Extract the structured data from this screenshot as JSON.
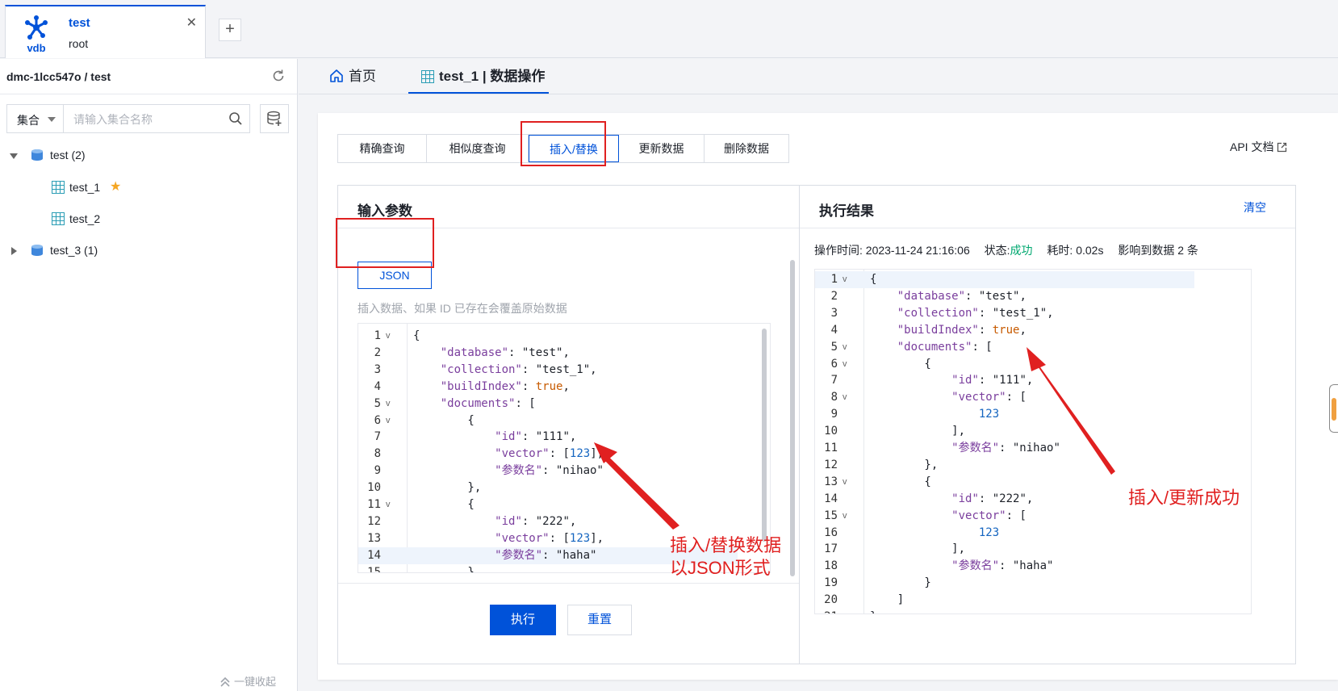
{
  "connection_tab": {
    "logo_text": "vdb",
    "name": "test",
    "user": "root",
    "close_glyph": "✕",
    "add_glyph": "+"
  },
  "sidebar": {
    "path_title": "dmc-1lcc547o / test",
    "refresh_icon": "refresh-icon",
    "search": {
      "scope": "集合",
      "placeholder": "请输入集合名称"
    },
    "tree": [
      {
        "label": "test (2)",
        "expanded": true,
        "children": [
          {
            "label": "test_1",
            "starred": true
          },
          {
            "label": "test_2",
            "starred": false
          }
        ]
      },
      {
        "label": "test_3 (1)",
        "expanded": false
      }
    ],
    "collapse_all": "一键收起"
  },
  "main_tabs": [
    {
      "label": "首页",
      "icon": "home-icon",
      "active": false
    },
    {
      "label": "test_1 | 数据操作",
      "icon": "table-icon",
      "active": true
    }
  ],
  "op_tabs": [
    {
      "label": "精确查询",
      "active": false
    },
    {
      "label": "相似度查询",
      "active": false
    },
    {
      "label": "插入/替换",
      "active": true
    },
    {
      "label": "更新数据",
      "active": false
    },
    {
      "label": "删除数据",
      "active": false
    }
  ],
  "api_doc": "API 文档",
  "input_panel": {
    "title": "输入参数",
    "format_button": "JSON",
    "hint": "插入数据、如果 ID 已存在会覆盖原始数据",
    "highlighted_line": 14,
    "code_lines": [
      [
        [
          "p",
          "{"
        ]
      ],
      [
        [
          "p",
          "    "
        ],
        [
          "k",
          "\"database\""
        ],
        [
          "p",
          ": "
        ],
        [
          "s",
          "\"test\""
        ],
        [
          "p",
          ","
        ]
      ],
      [
        [
          "p",
          "    "
        ],
        [
          "k",
          "\"collection\""
        ],
        [
          "p",
          ": "
        ],
        [
          "s",
          "\"test_1\""
        ],
        [
          "p",
          ","
        ]
      ],
      [
        [
          "p",
          "    "
        ],
        [
          "k",
          "\"buildIndex\""
        ],
        [
          "p",
          ": "
        ],
        [
          "b",
          "true"
        ],
        [
          "p",
          ","
        ]
      ],
      [
        [
          "p",
          "    "
        ],
        [
          "k",
          "\"documents\""
        ],
        [
          "p",
          ": ["
        ]
      ],
      [
        [
          "p",
          "        {"
        ]
      ],
      [
        [
          "p",
          "            "
        ],
        [
          "k",
          "\"id\""
        ],
        [
          "p",
          ": "
        ],
        [
          "s",
          "\"111\""
        ],
        [
          "p",
          ","
        ]
      ],
      [
        [
          "p",
          "            "
        ],
        [
          "k",
          "\"vector\""
        ],
        [
          "p",
          ": ["
        ],
        [
          "n",
          "123"
        ],
        [
          "p",
          "],"
        ]
      ],
      [
        [
          "p",
          "            "
        ],
        [
          "k",
          "\"参数名\""
        ],
        [
          "p",
          ": "
        ],
        [
          "s",
          "\"nihao\""
        ]
      ],
      [
        [
          "p",
          "        },"
        ]
      ],
      [
        [
          "p",
          "        {"
        ]
      ],
      [
        [
          "p",
          "            "
        ],
        [
          "k",
          "\"id\""
        ],
        [
          "p",
          ": "
        ],
        [
          "s",
          "\"222\""
        ],
        [
          "p",
          ","
        ]
      ],
      [
        [
          "p",
          "            "
        ],
        [
          "k",
          "\"vector\""
        ],
        [
          "p",
          ": ["
        ],
        [
          "n",
          "123"
        ],
        [
          "p",
          "],"
        ]
      ],
      [
        [
          "p",
          "            "
        ],
        [
          "k",
          "\"参数名\""
        ],
        [
          "p",
          ": "
        ],
        [
          "s",
          "\"haha\""
        ]
      ],
      [
        [
          "p",
          "        }"
        ]
      ]
    ],
    "fold_lines": [
      1,
      5,
      6,
      11
    ],
    "buttons": {
      "execute": "执行",
      "reset": "重置"
    }
  },
  "result_panel": {
    "title": "执行结果",
    "clear": "清空",
    "info": {
      "time_label": "操作时间:",
      "time_value": "2023-11-24 21:16:06",
      "status_label": "状态:",
      "status_value": "成功",
      "cost_label": "耗时:",
      "cost_value": "0.02s",
      "affected": "影响到数据 2 条"
    },
    "highlighted_line": 1,
    "code_lines": [
      [
        [
          "p",
          "{"
        ]
      ],
      [
        [
          "p",
          "    "
        ],
        [
          "k",
          "\"database\""
        ],
        [
          "p",
          ": "
        ],
        [
          "s",
          "\"test\""
        ],
        [
          "p",
          ","
        ]
      ],
      [
        [
          "p",
          "    "
        ],
        [
          "k",
          "\"collection\""
        ],
        [
          "p",
          ": "
        ],
        [
          "s",
          "\"test_1\""
        ],
        [
          "p",
          ","
        ]
      ],
      [
        [
          "p",
          "    "
        ],
        [
          "k",
          "\"buildIndex\""
        ],
        [
          "p",
          ": "
        ],
        [
          "b",
          "true"
        ],
        [
          "p",
          ","
        ]
      ],
      [
        [
          "p",
          "    "
        ],
        [
          "k",
          "\"documents\""
        ],
        [
          "p",
          ": ["
        ]
      ],
      [
        [
          "p",
          "        {"
        ]
      ],
      [
        [
          "p",
          "            "
        ],
        [
          "k",
          "\"id\""
        ],
        [
          "p",
          ": "
        ],
        [
          "s",
          "\"111\""
        ],
        [
          "p",
          ","
        ]
      ],
      [
        [
          "p",
          "            "
        ],
        [
          "k",
          "\"vector\""
        ],
        [
          "p",
          ": ["
        ]
      ],
      [
        [
          "p",
          "                "
        ],
        [
          "n",
          "123"
        ]
      ],
      [
        [
          "p",
          "            ],"
        ]
      ],
      [
        [
          "p",
          "            "
        ],
        [
          "k",
          "\"参数名\""
        ],
        [
          "p",
          ": "
        ],
        [
          "s",
          "\"nihao\""
        ]
      ],
      [
        [
          "p",
          "        },"
        ]
      ],
      [
        [
          "p",
          "        {"
        ]
      ],
      [
        [
          "p",
          "            "
        ],
        [
          "k",
          "\"id\""
        ],
        [
          "p",
          ": "
        ],
        [
          "s",
          "\"222\""
        ],
        [
          "p",
          ","
        ]
      ],
      [
        [
          "p",
          "            "
        ],
        [
          "k",
          "\"vector\""
        ],
        [
          "p",
          ": ["
        ]
      ],
      [
        [
          "p",
          "                "
        ],
        [
          "n",
          "123"
        ]
      ],
      [
        [
          "p",
          "            ],"
        ]
      ],
      [
        [
          "p",
          "            "
        ],
        [
          "k",
          "\"参数名\""
        ],
        [
          "p",
          ": "
        ],
        [
          "s",
          "\"haha\""
        ]
      ],
      [
        [
          "p",
          "        }"
        ]
      ],
      [
        [
          "p",
          "    ]"
        ]
      ],
      [
        [
          "p",
          "}"
        ]
      ]
    ],
    "fold_lines": [
      1,
      5,
      6,
      8,
      13,
      15
    ]
  },
  "annotations": {
    "left_note_line1": "插入/替换数据",
    "left_note_line2": "以JSON形式",
    "right_note": "插入/更新成功"
  },
  "colors": {
    "brand": "#0052d9",
    "annotation_red": "#e02020",
    "success": "#00a870",
    "json_key": "#7a3e9d",
    "json_bool": "#c75a00",
    "json_number": "#1565c0"
  }
}
